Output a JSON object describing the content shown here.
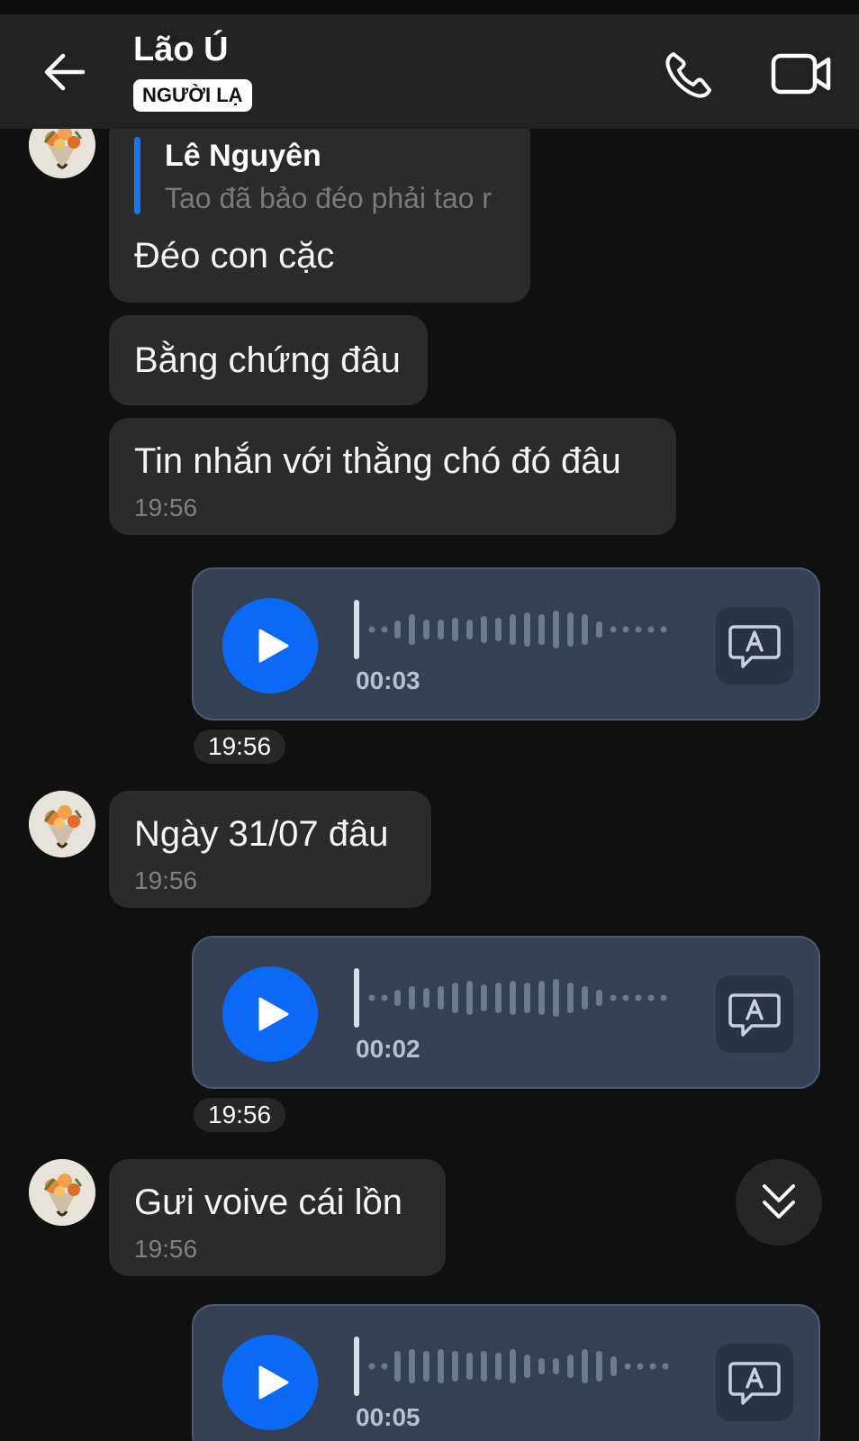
{
  "header": {
    "title": "Lão Ú",
    "badge": "NGƯỜI LẠ",
    "back_icon": "arrow-left-icon",
    "call_icon": "phone-icon",
    "video_icon": "video-camera-icon"
  },
  "messages": [
    {
      "type": "incoming-reply",
      "quote_name": "Lê Nguyên",
      "quote_text": "Tao đã bảo đéo phải tao r",
      "text": "Đéo con cặc"
    },
    {
      "type": "incoming",
      "text": "Bằng chứng đâu"
    },
    {
      "type": "incoming",
      "text": "Tin nhắn với thằng chó đó đâu",
      "time": "19:56"
    },
    {
      "type": "voice-outgoing",
      "duration": "00:03",
      "time": "19:56"
    },
    {
      "type": "incoming",
      "text": "Ngày 31/07 đâu",
      "time": "19:56"
    },
    {
      "type": "voice-outgoing",
      "duration": "00:02",
      "time": "19:56"
    },
    {
      "type": "incoming",
      "text": "Gưi voive cái lồn",
      "time": "19:56"
    },
    {
      "type": "voice-outgoing",
      "duration": "00:05"
    }
  ],
  "colors": {
    "background": "#101010",
    "header": "#222222",
    "bubble_incoming": "#2b2b2b",
    "voice_bubble": "#354052",
    "play_button": "#0a6af5",
    "quote_bar": "#1a73f4"
  }
}
